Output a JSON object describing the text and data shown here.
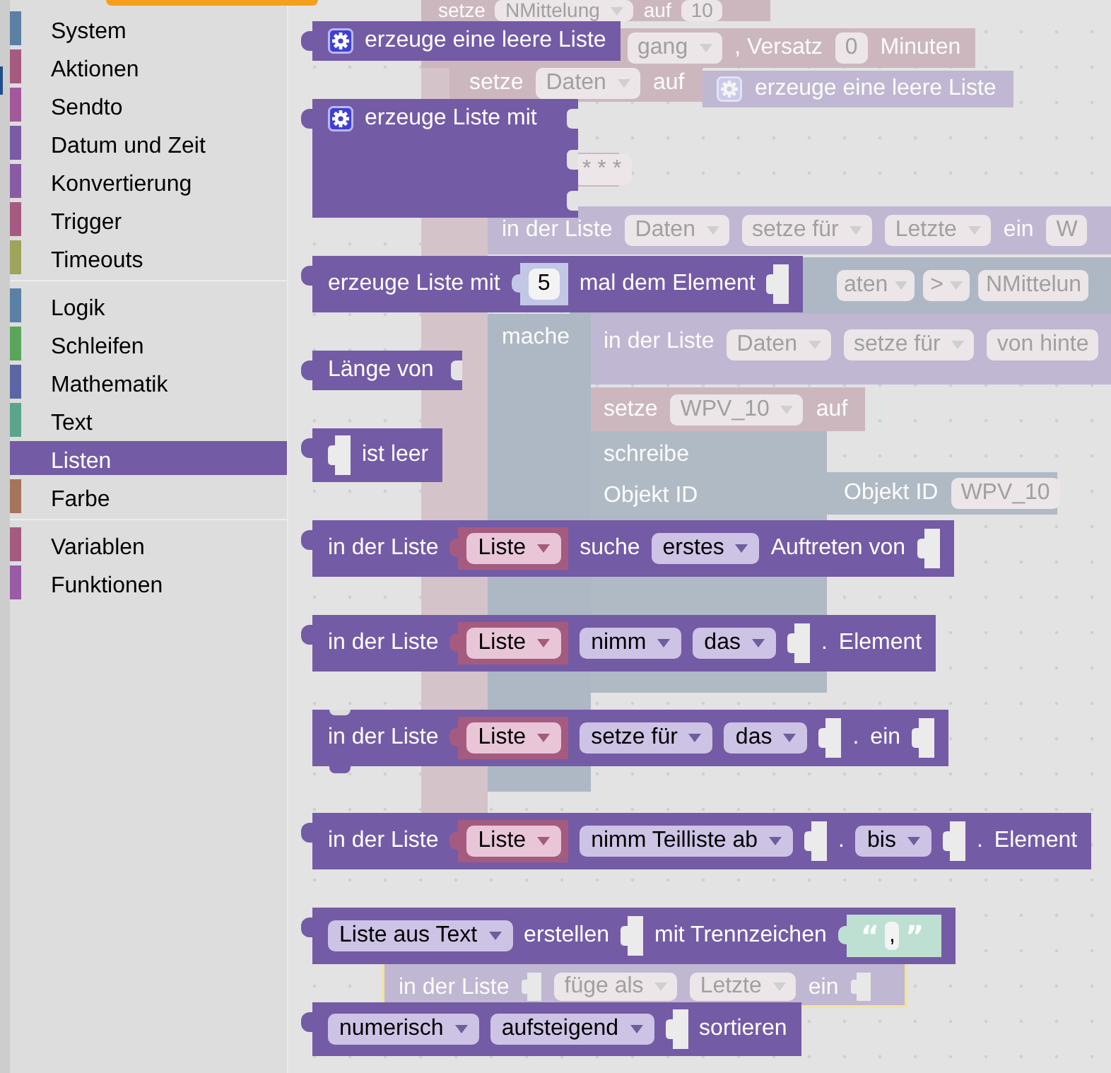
{
  "toolbox": {
    "groups": [
      {
        "items": [
          {
            "label": "System",
            "color": "#5b80a5",
            "selected": false
          },
          {
            "label": "Aktionen",
            "color": "#a55b80",
            "selected": false
          },
          {
            "label": "Sendto",
            "color": "#a5579b",
            "selected": false
          },
          {
            "label": "Datum und Zeit",
            "color": "#7a5ba5",
            "selected": false
          },
          {
            "label": "Konvertierung",
            "color": "#8a5ba5",
            "selected": false
          },
          {
            "label": "Trigger",
            "color": "#a55b80",
            "selected": false
          },
          {
            "label": "Timeouts",
            "color": "#9ca55b",
            "selected": false
          }
        ]
      },
      {
        "items": [
          {
            "label": "Logik",
            "color": "#5b80a5",
            "selected": false
          },
          {
            "label": "Schleifen",
            "color": "#5ba55b",
            "selected": false
          },
          {
            "label": "Mathematik",
            "color": "#5b67a5",
            "selected": false
          },
          {
            "label": "Text",
            "color": "#5ba58c",
            "selected": false
          },
          {
            "label": "Listen",
            "color": "#745ba5",
            "selected": true
          },
          {
            "label": "Farbe",
            "color": "#a5745b",
            "selected": false
          }
        ]
      },
      {
        "items": [
          {
            "label": "Variablen",
            "color": "#a55b80",
            "selected": false
          },
          {
            "label": "Funktionen",
            "color": "#995ba5",
            "selected": false
          }
        ]
      }
    ]
  },
  "flyout": {
    "blocks": [
      {
        "kind": "value",
        "parts": [
          {
            "kind": "gear"
          },
          {
            "kind": "label",
            "text": "erzeuge eine leere Liste"
          }
        ]
      },
      {
        "kind": "mutator",
        "parts": [
          {
            "kind": "gear"
          },
          {
            "kind": "label",
            "text": "erzeuge Liste mit"
          }
        ]
      },
      {
        "kind": "value",
        "parts": [
          {
            "kind": "label",
            "text": "erzeuge Liste mit"
          },
          {
            "kind": "number",
            "text": "5"
          },
          {
            "kind": "label",
            "text": "mal dem Element"
          },
          {
            "kind": "socket"
          }
        ]
      },
      {
        "kind": "value",
        "parts": [
          {
            "kind": "label",
            "text": "Länge von"
          },
          {
            "kind": "edge_socket"
          }
        ]
      },
      {
        "kind": "value",
        "parts": [
          {
            "kind": "socket"
          },
          {
            "kind": "label",
            "text": "ist leer"
          }
        ]
      },
      {
        "kind": "value",
        "parts": [
          {
            "kind": "label",
            "text": "in der Liste"
          },
          {
            "kind": "variable",
            "text": "Liste"
          },
          {
            "kind": "label",
            "text": "suche"
          },
          {
            "kind": "dropdown",
            "text": "erstes"
          },
          {
            "kind": "label",
            "text": "Auftreten von"
          },
          {
            "kind": "socket"
          }
        ]
      },
      {
        "kind": "value",
        "parts": [
          {
            "kind": "label",
            "text": "in der Liste"
          },
          {
            "kind": "variable",
            "text": "Liste"
          },
          {
            "kind": "dropdown",
            "text": "nimm"
          },
          {
            "kind": "dropdown",
            "text": "das"
          },
          {
            "kind": "socket"
          },
          {
            "kind": "label",
            "text": "."
          },
          {
            "kind": "label",
            "text": "Element"
          }
        ]
      },
      {
        "kind": "statement",
        "parts": [
          {
            "kind": "label",
            "text": "in der Liste"
          },
          {
            "kind": "variable",
            "text": "Liste"
          },
          {
            "kind": "dropdown",
            "text": "setze für"
          },
          {
            "kind": "dropdown",
            "text": "das"
          },
          {
            "kind": "socket"
          },
          {
            "kind": "label",
            "text": "."
          },
          {
            "kind": "label",
            "text": "ein"
          },
          {
            "kind": "socket"
          }
        ]
      },
      {
        "kind": "value",
        "parts": [
          {
            "kind": "label",
            "text": "in der Liste"
          },
          {
            "kind": "variable",
            "text": "Liste"
          },
          {
            "kind": "dropdown",
            "text": "nimm Teilliste ab"
          },
          {
            "kind": "socket"
          },
          {
            "kind": "label",
            "text": "."
          },
          {
            "kind": "dropdown",
            "text": "bis"
          },
          {
            "kind": "socket"
          },
          {
            "kind": "label",
            "text": "."
          },
          {
            "kind": "label",
            "text": "Element"
          }
        ]
      },
      {
        "kind": "value",
        "parts": [
          {
            "kind": "dropdown",
            "text": "Liste aus Text"
          },
          {
            "kind": "label",
            "text": "erstellen"
          },
          {
            "kind": "socket"
          },
          {
            "kind": "label",
            "text": "mit Trennzeichen"
          },
          {
            "kind": "text",
            "open": "“",
            "text": ",",
            "close": "”"
          }
        ]
      },
      {
        "kind": "value",
        "parts": [
          {
            "kind": "dropdown",
            "text": "numerisch"
          },
          {
            "kind": "dropdown",
            "text": "aufsteigend"
          },
          {
            "kind": "socket"
          },
          {
            "kind": "label",
            "text": "sortieren"
          }
        ]
      }
    ]
  },
  "workspace": {
    "blocks": [
      {
        "kind": "variable",
        "selected": false,
        "parts": [
          {
            "kind": "label",
            "text": "setze"
          },
          {
            "kind": "dropdown",
            "text": "NMittelung"
          },
          {
            "kind": "label",
            "text": "auf"
          },
          {
            "kind": "field",
            "text": "10"
          }
        ]
      },
      {
        "kind": "variable",
        "selected": false,
        "parts": [
          {
            "kind": "dropdown",
            "text": "gang"
          },
          {
            "kind": "label",
            "text": ", Versatz"
          },
          {
            "kind": "field",
            "text": "0"
          },
          {
            "kind": "label",
            "text": "Minuten"
          }
        ]
      },
      {
        "kind": "variable",
        "selected": false,
        "parts": [
          {
            "kind": "label",
            "text": "setze"
          },
          {
            "kind": "dropdown",
            "text": "Daten"
          },
          {
            "kind": "label",
            "text": "auf"
          }
        ]
      },
      {
        "kind": "list",
        "selected": false,
        "parts": [
          {
            "kind": "gear"
          },
          {
            "kind": "label",
            "text": "erzeuge eine leere Liste"
          }
        ]
      },
      {
        "kind": "variable",
        "selected": false,
        "parts": [
          {
            "kind": "field",
            "text": "* * *"
          }
        ]
      },
      {
        "kind": "list",
        "selected": false,
        "parts": [
          {
            "kind": "label",
            "text": "in der Liste"
          },
          {
            "kind": "dropdown",
            "text": "Daten"
          },
          {
            "kind": "dropdown",
            "text": "setze für"
          },
          {
            "kind": "dropdown",
            "text": "Letzte"
          },
          {
            "kind": "label",
            "text": "ein"
          },
          {
            "kind": "field",
            "text": "W"
          }
        ]
      },
      {
        "kind": "logic",
        "selected": false,
        "parts": [
          {
            "kind": "dropdown",
            "text": "aten"
          },
          {
            "kind": "dropdown",
            "text": ">"
          },
          {
            "kind": "field",
            "text": "NMittelun"
          }
        ]
      },
      {
        "kind": "logic",
        "selected": false,
        "parts": [
          {
            "kind": "label",
            "text": "mache"
          }
        ]
      },
      {
        "kind": "list",
        "selected": false,
        "parts": [
          {
            "kind": "label",
            "text": "in der Liste"
          },
          {
            "kind": "dropdown",
            "text": "Daten"
          },
          {
            "kind": "dropdown",
            "text": "setze für"
          },
          {
            "kind": "field",
            "text": "von hinte"
          }
        ]
      },
      {
        "kind": "variable",
        "selected": false,
        "parts": [
          {
            "kind": "label",
            "text": "setze"
          },
          {
            "kind": "dropdown",
            "text": "WPV_10"
          },
          {
            "kind": "label",
            "text": "auf"
          }
        ]
      },
      {
        "kind": "action",
        "selected": false,
        "parts": [
          {
            "kind": "label",
            "text": "schreibe"
          },
          {
            "kind": "label",
            "text": "Objekt ID"
          }
        ]
      },
      {
        "kind": "action",
        "selected": false,
        "parts": [
          {
            "kind": "label",
            "text": "Objekt ID"
          },
          {
            "kind": "field",
            "text": "WPV_10"
          }
        ]
      },
      {
        "kind": "list",
        "selected": true,
        "parts": [
          {
            "kind": "label",
            "text": "in der Liste"
          },
          {
            "kind": "socket"
          },
          {
            "kind": "dropdown",
            "text": "füge als"
          },
          {
            "kind": "dropdown",
            "text": "Letzte"
          },
          {
            "kind": "label",
            "text": "ein"
          },
          {
            "kind": "socket"
          }
        ]
      }
    ]
  }
}
